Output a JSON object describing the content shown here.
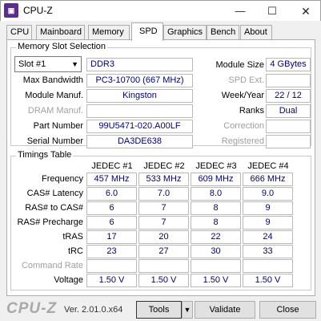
{
  "window": {
    "title": "CPU-Z",
    "minimize": "—",
    "maximize": "☐",
    "close": "✕",
    "icon": "cpu-z-app-icon"
  },
  "tabs": [
    "CPU",
    "Mainboard",
    "Memory",
    "SPD",
    "Graphics",
    "Bench",
    "About"
  ],
  "active_tab": "SPD",
  "slot_section": {
    "title": "Memory Slot Selection",
    "slot_selected": "Slot #1",
    "type": "DDR3",
    "module_size_label": "Module Size",
    "module_size": "4 GBytes",
    "max_bandwidth_label": "Max Bandwidth",
    "max_bandwidth": "PC3-10700 (667 MHz)",
    "spd_ext_label": "SPD Ext.",
    "spd_ext": "",
    "module_manuf_label": "Module Manuf.",
    "module_manuf": "Kingston",
    "week_year_label": "Week/Year",
    "week_year": "22 / 12",
    "dram_manuf_label": "DRAM Manuf.",
    "dram_manuf": "",
    "ranks_label": "Ranks",
    "ranks": "Dual",
    "part_number_label": "Part Number",
    "part_number": "99U5471-020.A00LF",
    "correction_label": "Correction",
    "correction": "",
    "serial_number_label": "Serial Number",
    "serial_number": "DA3DE638",
    "registered_label": "Registered",
    "registered": ""
  },
  "timings": {
    "title": "Timings Table",
    "columns": [
      "JEDEC #1",
      "JEDEC #2",
      "JEDEC #3",
      "JEDEC #4"
    ],
    "rows": [
      {
        "label": "Frequency",
        "values": [
          "457 MHz",
          "533 MHz",
          "609 MHz",
          "666 MHz"
        ]
      },
      {
        "label": "CAS# Latency",
        "values": [
          "6.0",
          "7.0",
          "8.0",
          "9.0"
        ]
      },
      {
        "label": "RAS# to CAS#",
        "values": [
          "6",
          "7",
          "8",
          "9"
        ]
      },
      {
        "label": "RAS# Precharge",
        "values": [
          "6",
          "7",
          "8",
          "9"
        ]
      },
      {
        "label": "tRAS",
        "values": [
          "17",
          "20",
          "22",
          "24"
        ]
      },
      {
        "label": "tRC",
        "values": [
          "23",
          "27",
          "30",
          "33"
        ]
      },
      {
        "label": "Command Rate",
        "values": [
          "",
          "",
          "",
          ""
        ]
      },
      {
        "label": "Voltage",
        "values": [
          "1.50 V",
          "1.50 V",
          "1.50 V",
          "1.50 V"
        ]
      }
    ]
  },
  "footer": {
    "logo": "CPU-Z",
    "version": "Ver. 2.01.0.x64",
    "tools_label": "Tools",
    "tools_arrow": "▼",
    "validate_label": "Validate",
    "close_label": "Close"
  }
}
